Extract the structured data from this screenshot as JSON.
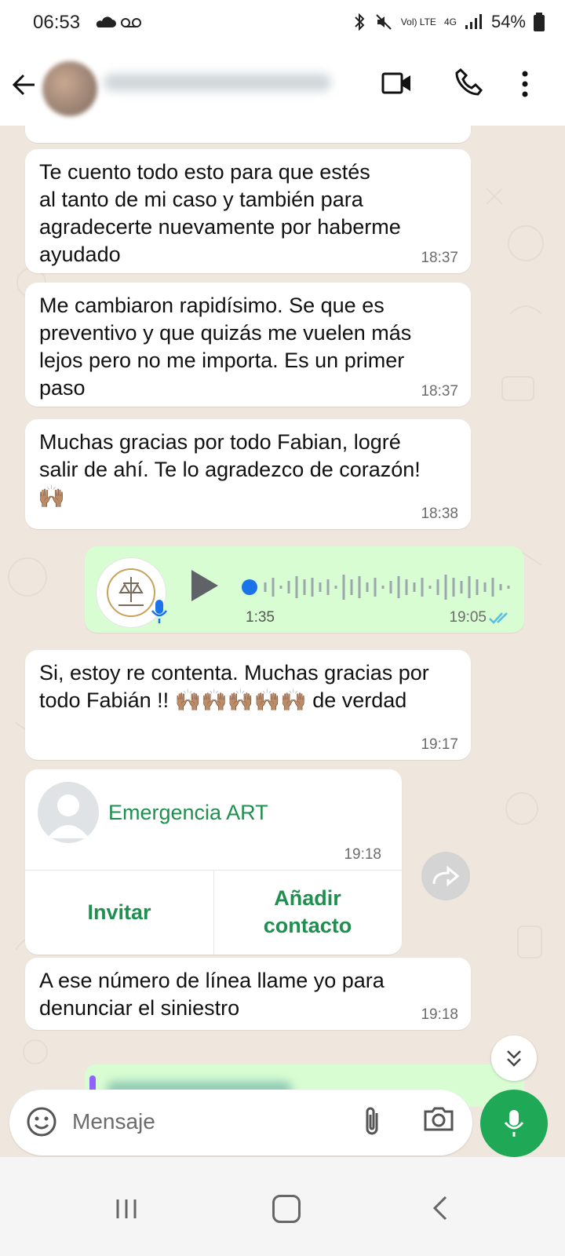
{
  "status_bar": {
    "time": "06:53",
    "network_label": "Vol) LTE",
    "signal_label": "4G",
    "battery": "54%"
  },
  "messages": [
    {
      "text": "Te cuento todo esto para que estés\nal tanto de mi caso y también para\nagradecerte nuevamente por haberme\nayudado",
      "time": "18:37"
    },
    {
      "text": "Me cambiaron rapidísimo. Se que es\npreventivo y que quizás me vuelen más\nlejos pero no me importa. Es un primer\npaso",
      "time": "18:37"
    },
    {
      "text": "Muchas gracias por todo Fabian, logré\nsalir de ahí. Te lo agradezco de corazón!",
      "time": "18:38",
      "emoji": "🙌🏽"
    },
    {
      "type": "voice",
      "duration": "1:35",
      "time": "19:05",
      "read": true
    },
    {
      "text": "Si, estoy re contenta. Muchas gracias por\ntodo Fabián !! 🙌🏽🙌🏽🙌🏽🙌🏽🙌🏽 de verdad",
      "time": "19:17"
    },
    {
      "type": "contact",
      "name": "Emergencia ART",
      "time": "19:18",
      "actions": [
        "Invitar",
        "Añadir\ncontacto"
      ]
    },
    {
      "text": "A ese número de línea llame yo para\ndenunciar el siniestro",
      "time": "19:18"
    }
  ],
  "composer": {
    "placeholder": "Mensaje"
  },
  "colors": {
    "accent": "#1fa855",
    "incoming": "#ffffff",
    "outgoing": "#d9fdd3",
    "contact": "#1e8f4e"
  },
  "icons": [
    "back-arrow-icon",
    "video-call-icon",
    "phone-icon",
    "more-options-icon",
    "emoji-icon",
    "attach-icon",
    "camera-icon",
    "mic-icon",
    "forward-icon",
    "scroll-down-icon"
  ]
}
